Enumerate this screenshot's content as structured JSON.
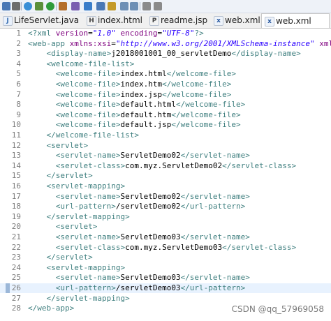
{
  "tabs": [
    {
      "label": "LifeServlet.java",
      "icon": "java-file-icon",
      "active": false
    },
    {
      "label": "index.html",
      "icon": "html-file-icon",
      "active": false
    },
    {
      "label": "readme.jsp",
      "icon": "jsp-file-icon",
      "active": false
    },
    {
      "label": "web.xml",
      "icon": "xml-file-icon",
      "active": false
    },
    {
      "label": "web.xml",
      "icon": "xml-file-icon",
      "active": true
    }
  ],
  "toolbar": {
    "icons": [
      "save-icon",
      "print-icon",
      "globe-icon",
      "debug-icon",
      "run-icon",
      "external-tools-icon",
      "new-server-icon",
      "open-type-icon",
      "search-icon",
      "edit-icon",
      "next-annotation-icon",
      "prev-annotation-icon",
      "back-icon",
      "forward-icon"
    ]
  },
  "editor": {
    "current_line": 26,
    "lines": [
      {
        "n": "1",
        "indent": "",
        "parts": [
          [
            "pi",
            "<?xml "
          ],
          [
            "attr",
            "version"
          ],
          [
            "txt",
            "="
          ],
          [
            "val",
            "\"1.0\""
          ],
          [
            "txt",
            " "
          ],
          [
            "attr",
            "encoding"
          ],
          [
            "txt",
            "="
          ],
          [
            "val",
            "\"UTF-8\""
          ],
          [
            "pi",
            "?>"
          ]
        ]
      },
      {
        "n": "2",
        "indent": "",
        "parts": [
          [
            "tag",
            "<web-app "
          ],
          [
            "attr",
            "xmlns:xsi"
          ],
          [
            "txt",
            "="
          ],
          [
            "val",
            "\"http://www.w3.org/2001/XMLSchema-instance\""
          ],
          [
            "txt",
            " "
          ],
          [
            "attr",
            "xmlns="
          ]
        ]
      },
      {
        "n": "3",
        "indent": "    ",
        "parts": [
          [
            "tag",
            "<display-name>"
          ],
          [
            "txt",
            "j2018001001_00_servletDemo"
          ],
          [
            "tag",
            "</display-name>"
          ]
        ]
      },
      {
        "n": "4",
        "indent": "    ",
        "parts": [
          [
            "tag",
            "<welcome-file-list>"
          ]
        ]
      },
      {
        "n": "5",
        "indent": "      ",
        "parts": [
          [
            "tag",
            "<welcome-file>"
          ],
          [
            "txt",
            "index.html"
          ],
          [
            "tag",
            "</welcome-file>"
          ]
        ]
      },
      {
        "n": "6",
        "indent": "      ",
        "parts": [
          [
            "tag",
            "<welcome-file>"
          ],
          [
            "txt",
            "index.htm"
          ],
          [
            "tag",
            "</welcome-file>"
          ]
        ]
      },
      {
        "n": "7",
        "indent": "      ",
        "parts": [
          [
            "tag",
            "<welcome-file>"
          ],
          [
            "txt",
            "index.jsp"
          ],
          [
            "tag",
            "</welcome-file>"
          ]
        ]
      },
      {
        "n": "8",
        "indent": "      ",
        "parts": [
          [
            "tag",
            "<welcome-file>"
          ],
          [
            "txt",
            "default.html"
          ],
          [
            "tag",
            "</welcome-file>"
          ]
        ]
      },
      {
        "n": "9",
        "indent": "      ",
        "parts": [
          [
            "tag",
            "<welcome-file>"
          ],
          [
            "txt",
            "default.htm"
          ],
          [
            "tag",
            "</welcome-file>"
          ]
        ]
      },
      {
        "n": "10",
        "indent": "      ",
        "parts": [
          [
            "tag",
            "<welcome-file>"
          ],
          [
            "txt",
            "default.jsp"
          ],
          [
            "tag",
            "</welcome-file>"
          ]
        ]
      },
      {
        "n": "11",
        "indent": "    ",
        "parts": [
          [
            "tag",
            "</welcome-file-list>"
          ]
        ]
      },
      {
        "n": "12",
        "indent": "    ",
        "parts": [
          [
            "tag",
            "<servlet>"
          ]
        ]
      },
      {
        "n": "13",
        "indent": "      ",
        "parts": [
          [
            "tag",
            "<servlet-name>"
          ],
          [
            "txt",
            "ServletDemo02"
          ],
          [
            "tag",
            "</servlet-name>"
          ]
        ]
      },
      {
        "n": "14",
        "indent": "      ",
        "parts": [
          [
            "tag",
            "<servlet-class>"
          ],
          [
            "txt",
            "com.myz.ServletDemo02"
          ],
          [
            "tag",
            "</servlet-class>"
          ]
        ]
      },
      {
        "n": "15",
        "indent": "    ",
        "parts": [
          [
            "tag",
            "</servlet>"
          ]
        ]
      },
      {
        "n": "16",
        "indent": "    ",
        "parts": [
          [
            "tag",
            "<servlet-mapping>"
          ]
        ]
      },
      {
        "n": "17",
        "indent": "      ",
        "parts": [
          [
            "tag",
            "<servlet-name>"
          ],
          [
            "txt",
            "ServletDemo02"
          ],
          [
            "tag",
            "</servlet-name>"
          ]
        ]
      },
      {
        "n": "18",
        "indent": "      ",
        "parts": [
          [
            "tag",
            "<url-pattern>"
          ],
          [
            "txt",
            "/servletDemo02"
          ],
          [
            "tag",
            "</url-pattern>"
          ]
        ]
      },
      {
        "n": "19",
        "indent": "    ",
        "parts": [
          [
            "tag",
            "</servlet-mapping>"
          ]
        ]
      },
      {
        "n": "20",
        "indent": "      ",
        "parts": [
          [
            "tag",
            "<servlet>"
          ]
        ]
      },
      {
        "n": "21",
        "indent": "      ",
        "parts": [
          [
            "tag",
            "<servlet-name>"
          ],
          [
            "txt",
            "ServletDemo03"
          ],
          [
            "tag",
            "</servlet-name>"
          ]
        ]
      },
      {
        "n": "22",
        "indent": "      ",
        "parts": [
          [
            "tag",
            "<servlet-class>"
          ],
          [
            "txt",
            "com.myz.ServletDemo03"
          ],
          [
            "tag",
            "</servlet-class>"
          ]
        ]
      },
      {
        "n": "23",
        "indent": "    ",
        "parts": [
          [
            "tag",
            "</servlet>"
          ]
        ]
      },
      {
        "n": "24",
        "indent": "    ",
        "parts": [
          [
            "tag",
            "<servlet-mapping>"
          ]
        ]
      },
      {
        "n": "25",
        "indent": "      ",
        "parts": [
          [
            "tag",
            "<servlet-name>"
          ],
          [
            "txt",
            "ServletDemo03"
          ],
          [
            "tag",
            "</servlet-name>"
          ]
        ]
      },
      {
        "n": "26",
        "indent": "      ",
        "parts": [
          [
            "tag",
            "<url-pattern>"
          ],
          [
            "txt",
            "/servletDemo03"
          ],
          [
            "tag",
            "</url-pattern>"
          ]
        ]
      },
      {
        "n": "27",
        "indent": "    ",
        "parts": [
          [
            "tag",
            "</servlet-mapping>"
          ]
        ]
      },
      {
        "n": "28",
        "indent": "",
        "parts": [
          [
            "tag",
            "</web-app>"
          ]
        ]
      }
    ]
  },
  "watermark": "CSDN @qq_57969058",
  "colors": {
    "tag": "#3f7f7f",
    "attr": "#7f007f",
    "value": "#2a00ff",
    "current_line_bg": "#e8f2fe"
  }
}
